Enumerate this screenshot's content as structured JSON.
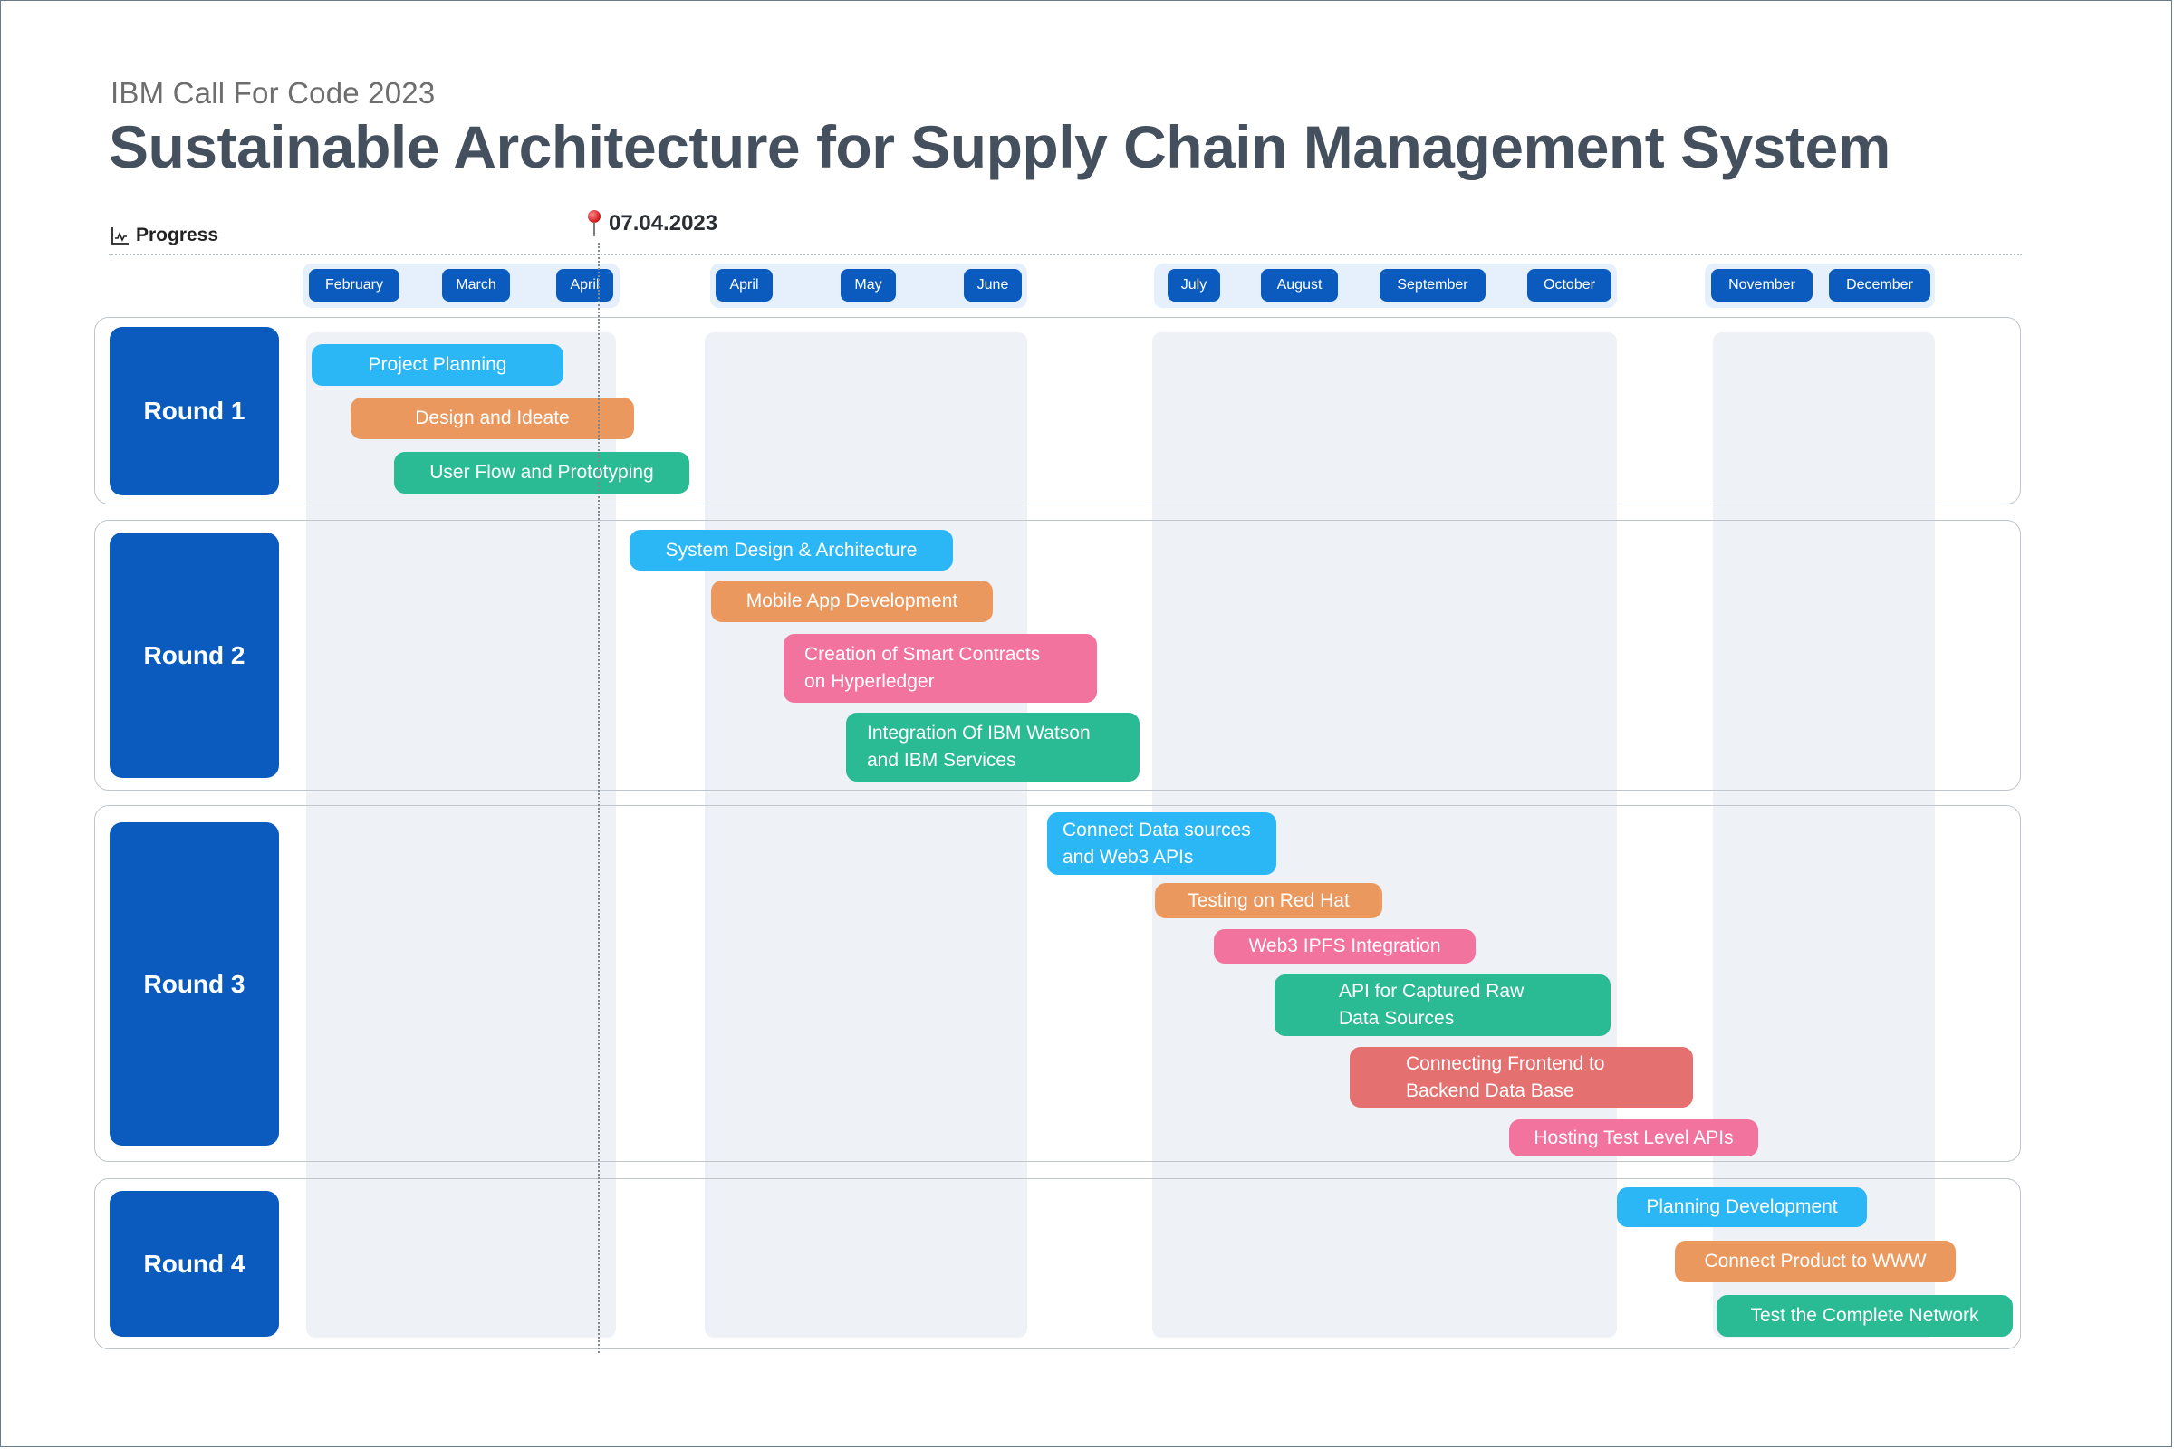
{
  "header": {
    "subtitle": "IBM Call For Code 2023",
    "title": "Sustainable Architecture for Supply Chain Management System",
    "progress_label": "Progress",
    "progress_icon": "line-chart-icon",
    "today_marker": {
      "icon": "pushpin-icon",
      "date": "07.04.2023"
    }
  },
  "months": [
    "February",
    "March",
    "April",
    "April",
    "May",
    "June",
    "July",
    "August",
    "September",
    "October",
    "November",
    "December"
  ],
  "colors": {
    "round_box": "#0a5bbd",
    "blue": "#2bb7f5",
    "orange": "#ea985e",
    "pink": "#f2739d",
    "green": "#2aba94",
    "red": "#e57070",
    "column_bg": "#eef1f5",
    "month_group_bg": "#e6f0fc"
  },
  "rounds": [
    {
      "label": "Round 1",
      "tasks": [
        {
          "label": "Project Planning",
          "color": "blue"
        },
        {
          "label": "Design and Ideate",
          "color": "orange"
        },
        {
          "label": "User Flow and Prototyping",
          "color": "green"
        }
      ]
    },
    {
      "label": "Round 2",
      "tasks": [
        {
          "label": "System Design & Architecture",
          "color": "blue"
        },
        {
          "label": "Mobile App Development",
          "color": "orange"
        },
        {
          "label": "Creation of Smart Contracts\non Hyperledger",
          "color": "pink"
        },
        {
          "label": "Integration Of IBM Watson\nand IBM Services",
          "color": "green"
        }
      ]
    },
    {
      "label": "Round 3",
      "tasks": [
        {
          "label": "Connect Data sources\n and Web3 APIs",
          "color": "blue"
        },
        {
          "label": "Testing on Red Hat",
          "color": "orange"
        },
        {
          "label": "Web3 IPFS Integration",
          "color": "pink"
        },
        {
          "label": "API for Captured Raw\nData Sources",
          "color": "green"
        },
        {
          "label": "Connecting Frontend to\nBackend Data Base",
          "color": "red"
        },
        {
          "label": "Hosting Test Level APIs",
          "color": "pink"
        }
      ]
    },
    {
      "label": "Round 4",
      "tasks": [
        {
          "label": "Planning Development",
          "color": "blue"
        },
        {
          "label": "Connect Product to WWW",
          "color": "orange"
        },
        {
          "label": "Test the Complete Network",
          "color": "green"
        }
      ]
    }
  ]
}
